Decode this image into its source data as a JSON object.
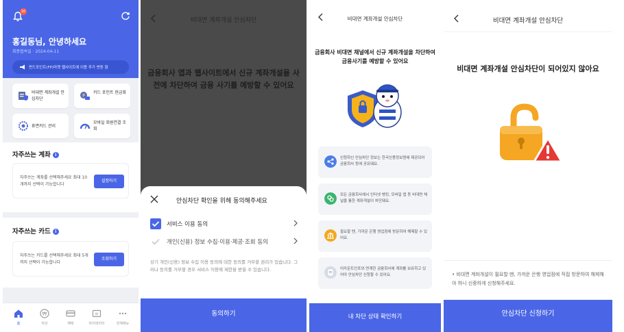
{
  "screen1": {
    "notification_count": "10",
    "greeting": "홍길동님, 안녕하세요",
    "last_login": "최종접속일 · 2024-04-11",
    "notice": "펀드포인트(FP)마켓 웹사이트에 이용 추가 변동 함",
    "menu": [
      {
        "label": "비대면 계좌개설 안심차단",
        "icon": "shield-doc-icon"
      },
      {
        "label": "카드 포인트 현금화",
        "icon": "coin-card-icon"
      },
      {
        "label": "휴면카드 관리",
        "icon": "card-gear-icon"
      },
      {
        "label": "모바일 회원연결 조회",
        "icon": "gauge-icon"
      }
    ],
    "accounts_section": {
      "title": "자주쓰는 계좌",
      "info": "i",
      "text": "자주쓰는 계좌를 선택해주세요 최대 10개까지 선택이 가능합니다",
      "button": "설정하기"
    },
    "cards_section": {
      "title": "자주쓰는 카드",
      "info": "i",
      "text": "자주쓰는 카드를 선택해주세요 최대 5개까지 선택이 가능합니다",
      "button": "조회하기"
    },
    "nav": [
      {
        "label": "홈",
        "icon": "home-icon",
        "active": true
      },
      {
        "label": "자산",
        "icon": "won-icon",
        "active": false
      },
      {
        "label": "혜택",
        "icon": "card-icon",
        "active": false
      },
      {
        "label": "마이데이터",
        "icon": "wallet-icon",
        "active": false
      },
      {
        "label": "전체메뉴",
        "icon": "more-icon",
        "active": false
      }
    ],
    "colors": {
      "brand": "#4a66e6",
      "badge": "#ff5a4a"
    }
  },
  "screen2": {
    "title": "비대면 계좌개설 안심차단",
    "headline": "금융회사 앱과 웹사이트에서 신규 계좌개설을 사전에 차단하여 금융 사기를 예방할 수 있어요",
    "sheet_title": "안심차단 확인을 위해 동의해주세요",
    "consents": [
      {
        "label": "서비스 이용 동의",
        "checked": true
      },
      {
        "label": "개인(신용) 정보 수집·이용·제공·조회 동의",
        "checked": false
      }
    ],
    "fine_print": "상기 개인(신용) 정보 수집 이용 동의에 대한 동의를 거부할 권리가 있습니다. 그러나 동의를 거부할 경우 서비스 이용에 제한을 받을 수 있습니다.",
    "confirm_button": "동의하기"
  },
  "screen3": {
    "title": "비대면 계좌개설 안심차단",
    "headline": "금융회사 비대면 채널에서 신규 계좌개설을 차단하여 금융사기를 예방할 수 있어요",
    "illustration": "mascot-shield-icon",
    "cards": [
      {
        "icon": "share-icon",
        "icon_color": "#4a7de6",
        "text": "신청하신 안심차단 정보는 한국신용정보원에 제공되어 금융회사 등에 공유돼요."
      },
      {
        "icon": "link-icon",
        "icon_color": "#3cb46e",
        "text": "모든 금융회사에서 인터넷 뱅킹, 모바일 앱 등 비대면 채널을 통한 계좌개설이 차단돼요."
      },
      {
        "icon": "bank-icon",
        "icon_color": "#f2a81d",
        "text": "필요할 땐, 가까운 은행 영업점에 방문하여 해제할 수 있어요."
      },
      {
        "icon": "doc-icon",
        "icon_color": "#9aa4b8",
        "text": "어카운트인포와 연계한 금융회사에 계좌를 보유하고 있어야 안심차단 신청할 수 있어요."
      }
    ],
    "button": "내 차단 상태 확인하기"
  },
  "screen4": {
    "title": "비대면 계좌개설 안심차단",
    "headline": "비대면 계좌개설 안심차단이 되어있지 않아요",
    "illustration": "unlocked-padlock-warning-icon",
    "note": "비대면 계좌개설이 필요할 땐, 가까운 은행 영업점에 직접 방문하여 해제해야 하니 신중하게 신청해주세요.",
    "button": "안심차단 신청하기",
    "colors": {
      "lock": "#f5a623",
      "warning": "#e53935"
    }
  }
}
